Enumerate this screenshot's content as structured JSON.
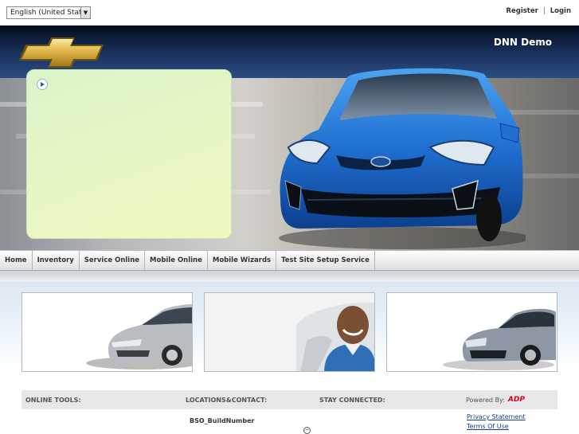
{
  "top": {
    "language": "English (United States)",
    "register": "Register",
    "separator": "|",
    "login": "Login"
  },
  "header": {
    "site_title": "DNN Demo"
  },
  "nav": {
    "items": [
      {
        "label": "Home"
      },
      {
        "label": "Inventory"
      },
      {
        "label": "Service Online"
      },
      {
        "label": "Mobile Online"
      },
      {
        "label": "Mobile Wizards"
      },
      {
        "label": "Test Site Setup Service"
      }
    ]
  },
  "footer": {
    "online_tools": "ONLINE TOOLS:",
    "locations": "LOCATIONS&CONTACT:",
    "stay_connected": "STAY CONNECTED:",
    "powered_by": "Powered By:",
    "powered_brand": "ADP",
    "build_number": "BSO_BuildNumber",
    "privacy": "Privacy Statement",
    "terms": "Terms Of Use"
  },
  "colors": {
    "link": "#1a3f8a",
    "brand_gold": "#d4a72c",
    "adp_red": "#d0021b",
    "car_blue": "#1f6fd0"
  }
}
